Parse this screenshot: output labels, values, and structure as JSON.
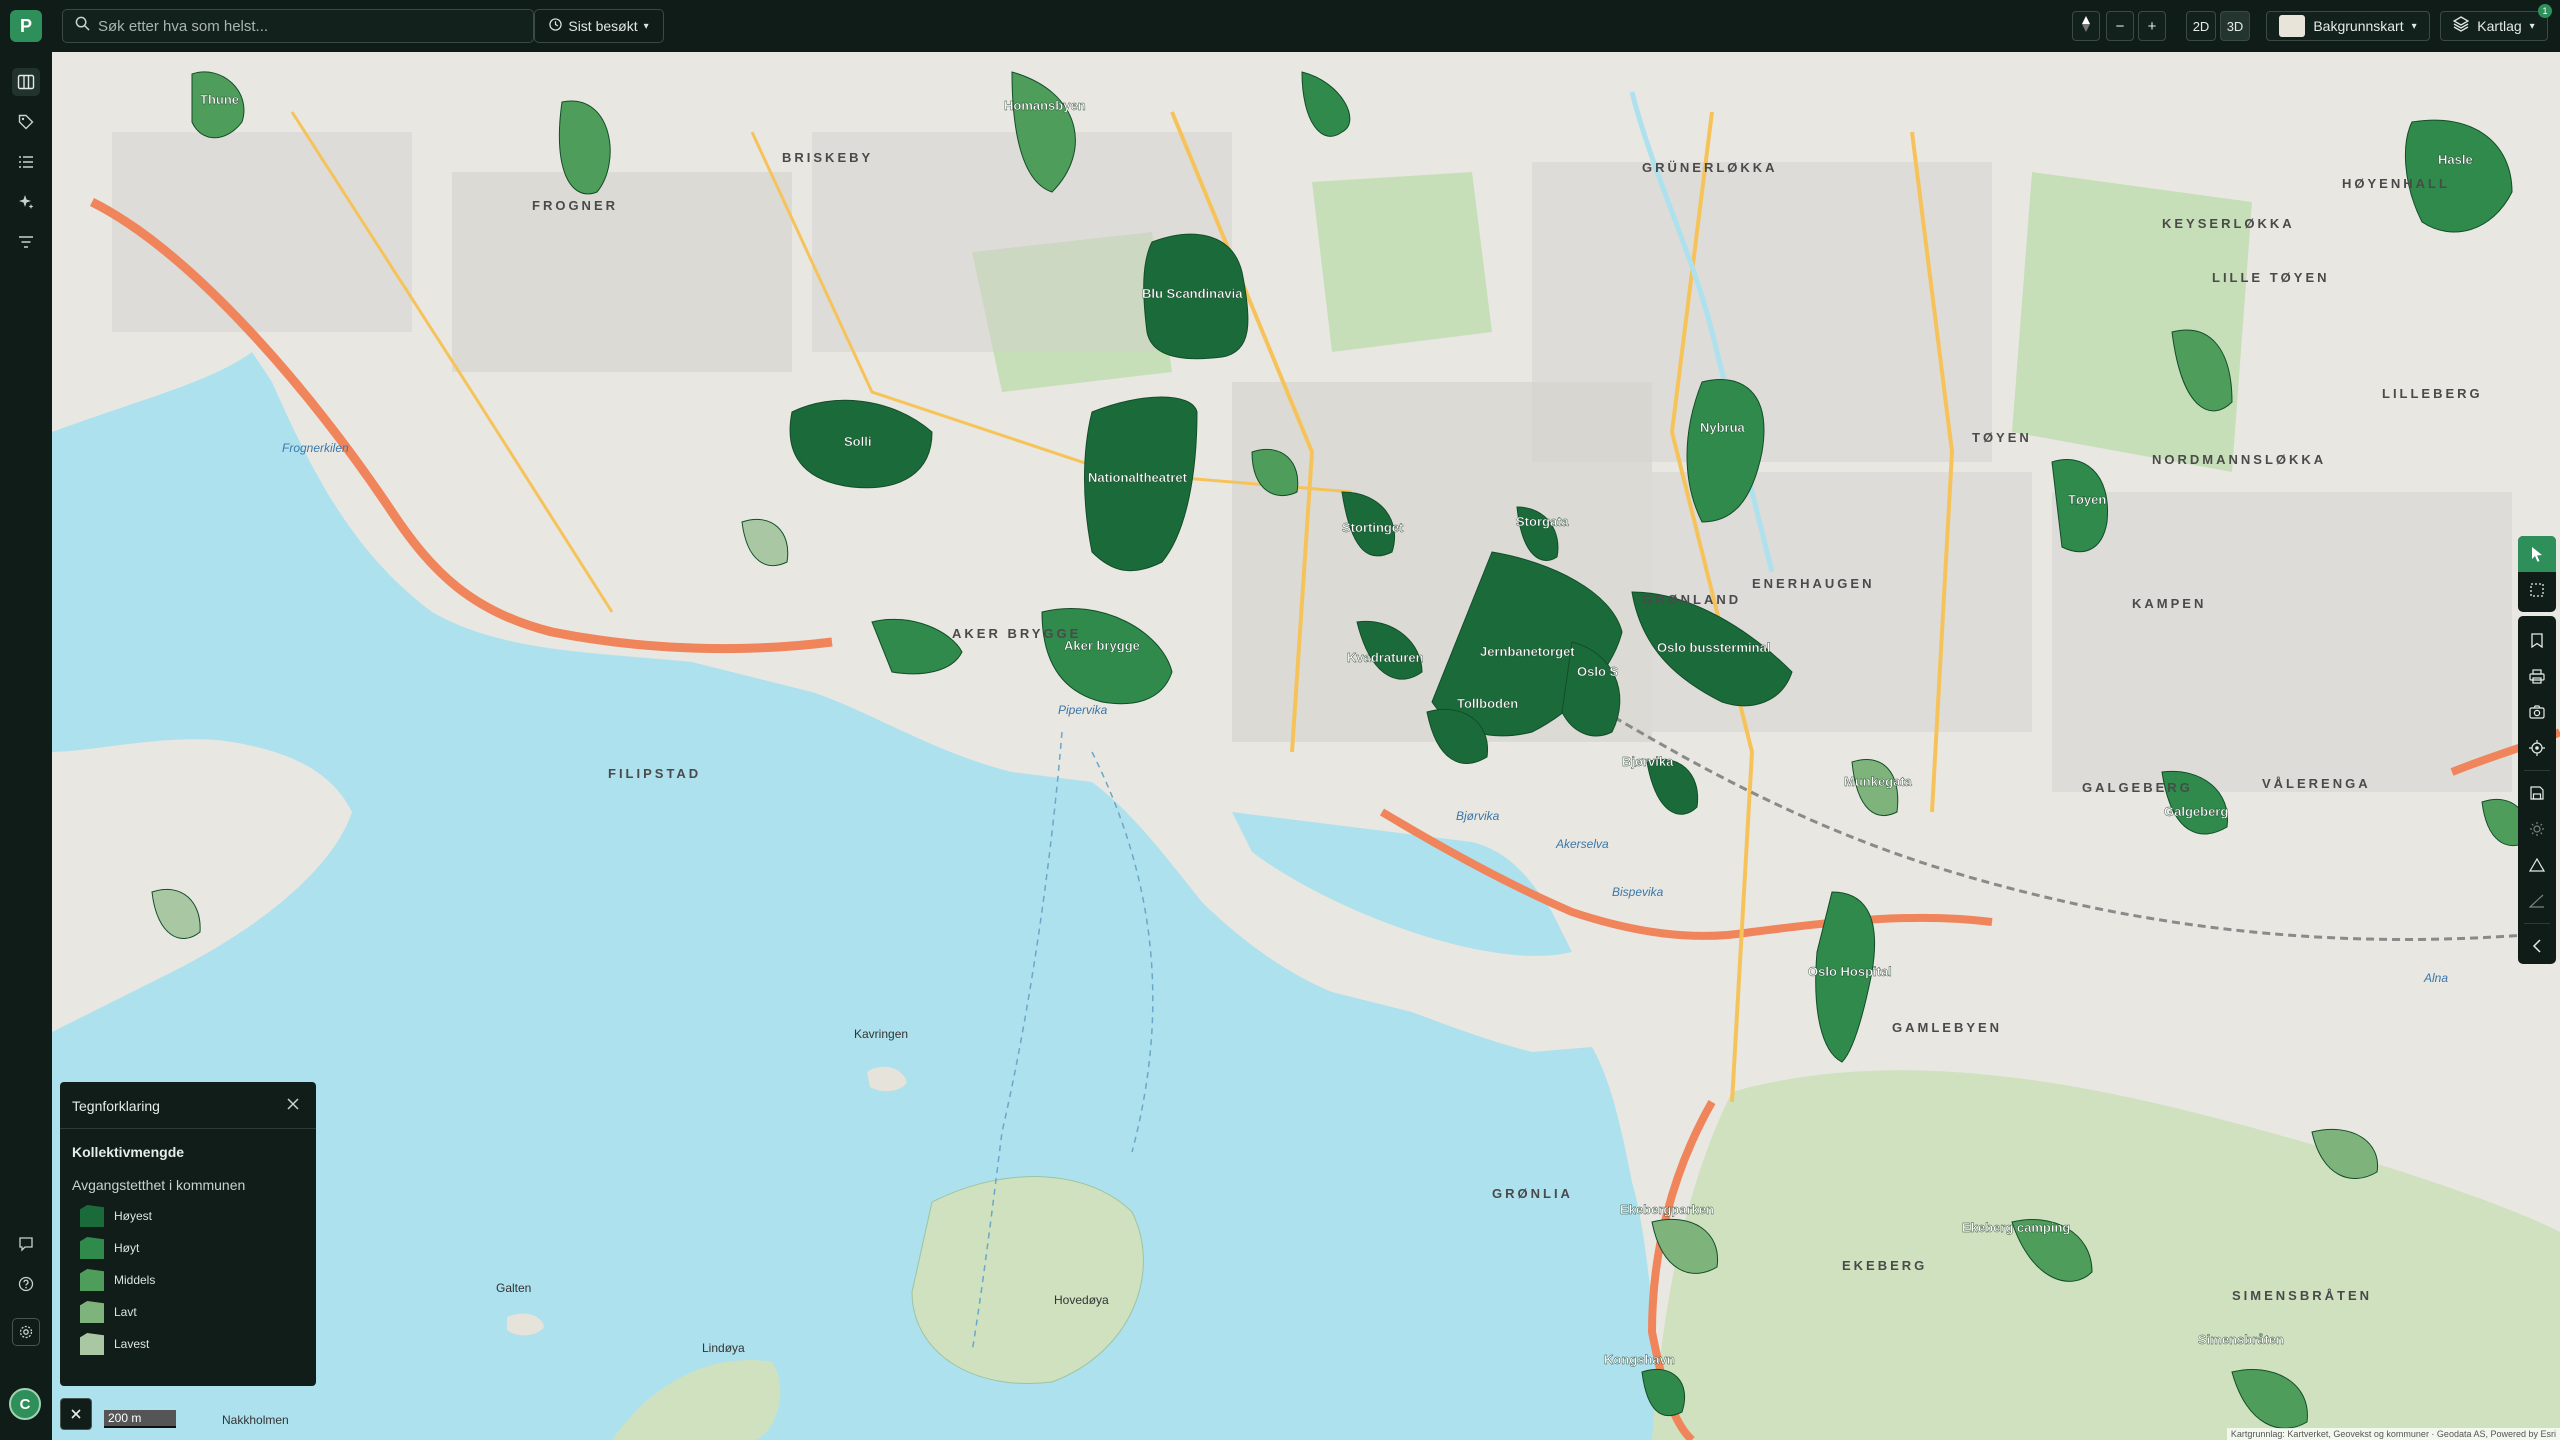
{
  "topbar": {
    "logo_letter": "P",
    "search_placeholder": "Søk etter hva som helst...",
    "recent_label": "Sist besøkt",
    "zoom_out": "−",
    "zoom_in": "+",
    "mode_2d": "2D",
    "mode_3d": "3D",
    "basemap_label": "Bakgrunnskart",
    "layers_label": "Kartlag",
    "layers_badge": "1"
  },
  "leftbar": {
    "icons": [
      "map-icon",
      "tag-icon",
      "list-icon",
      "sparkle-icon",
      "filter-icon"
    ],
    "bottom_icons": [
      "chat-icon",
      "help-icon",
      "settings-icon"
    ],
    "avatar_letter": "C"
  },
  "legend": {
    "title": "Tegnforklaring",
    "layer_name": "Kollektivmengde",
    "subtitle": "Avgangstetthet i kommunen",
    "items": [
      {
        "label": "Høyest",
        "color": "#1b6b3a"
      },
      {
        "label": "Høyt",
        "color": "#2f8a4b"
      },
      {
        "label": "Middels",
        "color": "#4f9d5b"
      },
      {
        "label": "Lavt",
        "color": "#7fb37c"
      },
      {
        "label": "Lavest",
        "color": "#a9c7a3"
      }
    ]
  },
  "scale_label": "200 m",
  "attribution": "Kartgrunnlag: Kartverket, Geovekst og kommuner · Geodata AS, Powered by Esri",
  "map": {
    "district_labels": [
      "BRISKEBY",
      "FROGNER",
      "GRÜNERLØKKA",
      "KEYSERLØKKA",
      "LILLE TØYEN",
      "LILLEBERG",
      "TØYEN",
      "NORDMANNSLØKKA",
      "GRØNLAND",
      "KAMPEN",
      "AKER BRYGGE",
      "FILIPSTAD",
      "GAMLEBYEN",
      "VÅLERENGA",
      "GALGEBERG",
      "GRØNLIA",
      "EKEBERG",
      "SIMENSBRÅTEN",
      "ENERHAUGEN",
      "HØYENHALL"
    ],
    "zones": [
      "Thune",
      "Homansbyen",
      "Nationaltheatret",
      "Solli",
      "Blu Scandinavia",
      "Stortinget",
      "Jernbanetorget",
      "Oslo bussterminal",
      "Oslo S",
      "Tollboden",
      "Storgata",
      "Nybrua",
      "Tøyen",
      "Bjørvika",
      "Aker brygge",
      "Kvadraturen",
      "Oslo Hospital",
      "Galgeberg",
      "Hasle",
      "Munkegata",
      "Ekebergparken",
      "Ekeberg camping",
      "Simensbråten",
      "Kongshavn"
    ],
    "water_labels": [
      "Pipervika",
      "Frognerkilen",
      "Bjørvika",
      "Akerselva",
      "Bispevika",
      "Alna"
    ],
    "islands": [
      "Hovedøya",
      "Kavringen",
      "Galten",
      "Nakkholmen",
      "Lindøya"
    ]
  },
  "map_panel": {
    "tools": [
      "cursor-icon",
      "select-box-icon",
      "bookmark-icon",
      "print-icon",
      "camera-icon",
      "location-icon",
      "save-icon",
      "sun-icon",
      "measure-icon",
      "angle-icon",
      "collapse-icon"
    ]
  }
}
